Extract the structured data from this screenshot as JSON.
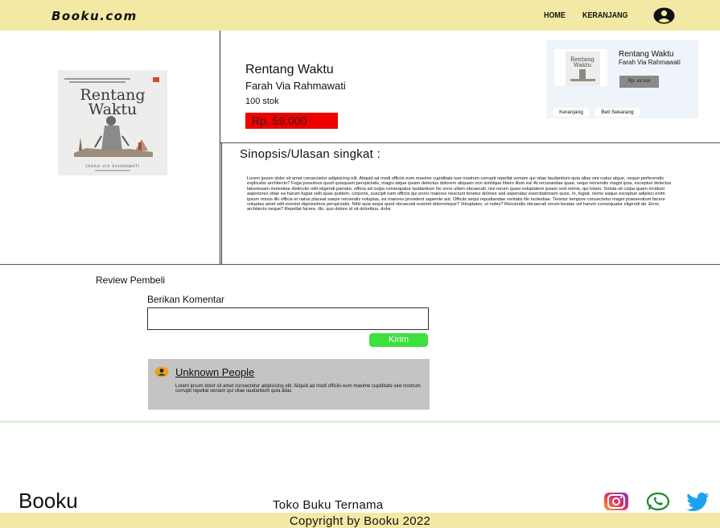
{
  "nav": {
    "brand": "Booku.com",
    "home": "HOME",
    "cart": "KERANJANG"
  },
  "product": {
    "cover_title": "Rentang Waktu",
    "cover_author": "FARAH VIA RAHMAWATI",
    "title": "Rentang Waktu",
    "author": "Farah Via Rahmawati",
    "stock": "100 stok",
    "price": "Rp. 59.000"
  },
  "card": {
    "title": "Rentang Waktu",
    "author": "Farah Via Rahmawati",
    "price": "Rp. xx.xxx",
    "cart_button": "Keranjang",
    "buy_button": "Beli Sekarang"
  },
  "synopsis": {
    "heading": "Sinopsis/Ulasan singkat :",
    "text": "Lorem ipsum dolor sit amet consectetur adipisicing elit. Aliquid ad modi officiis eum maxime cupiditate iure nostrum corrupti repellat veniam qui vitae laudantium quia alias sint natus atque, neque perferendis explicabo architecto? Fuga possimus quod quisquam perspiciatis, magni atque ipsam delectus dolorem aliquam non similique libero illum ea! At recusandae quae, sequi reiciendis magni ipsa, excepturi delectus laboriosam molestiae distinctio odit eligendi pariatur, officia ad culpa consequatur laudantium hic error ullam obcaecati, nisi rerum quasi voluptatem ipsam sed omnis, qui totam. Soluta sit culpa quam incidunt asperiores vitae ea harum fugiat velit quas quidem, corporis, suscipit nam officiis qui porro maiores nesciunt tenetur dolores sed asperiatur exercitationem quos. In, fugiat, nemo eaque excepturi adipisci enim ipsum minus illo officia et natus placeat saepe reiciendis voluptas, ea maiores provident sapiente aut. Officiis sequi repudiandae veritatis illo molestiae. Tenetur tempore consectetur magni praesentium facere voluptas amet odit eveniet dignissimos perspiciatis. Nihil quia sequi quod obcaecati eveniet doloremque? Voluptates, ut nobis? Reiciendis obcaecati rerum beatae vel harum consequatur eligendi ab. Error, architecto neque? Repellat facere, illo, quo dolore id sit doloribus, dolor"
  },
  "reviews": {
    "heading": "Review Pembeli",
    "comment_label": "Berikan Komentar",
    "comment_value": "",
    "send_button": "Kirim",
    "items": [
      {
        "name": "Unknown People",
        "text": "Lorem ipsum dolor sit amet consectetur adipisicing elit. Aliquid ad modi officiis eum maxime cupiditate iure nostrum corrupti repellat veniam qui vitae laudantium quia alias"
      }
    ]
  },
  "footer": {
    "brand": "Booku",
    "tagline": "Toko Buku Ternama",
    "copyright": "Copyright by Booku 2022",
    "social_icons": [
      "instagram-icon",
      "whatsapp-icon",
      "twitter-icon"
    ]
  },
  "colors": {
    "header_bg": "#f4e9a4",
    "price_bg": "#ee0000",
    "send_button_bg": "#3ee03e",
    "card_bg": "#eef4fa",
    "review_bg": "#c4c4c4"
  }
}
